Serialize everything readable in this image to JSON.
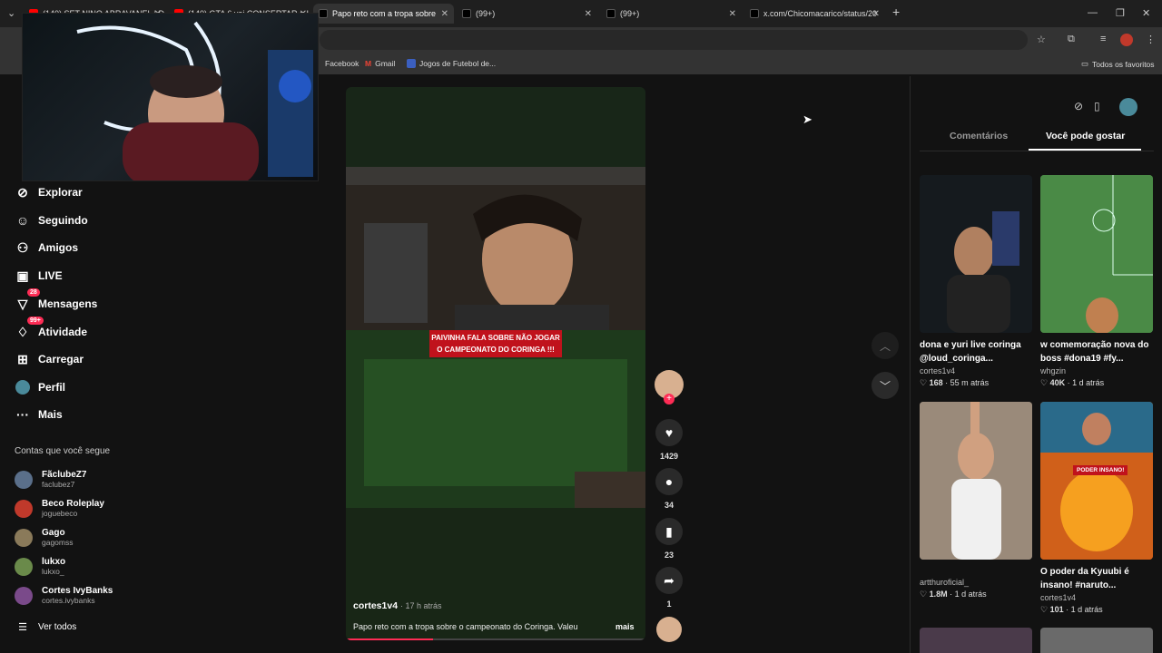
{
  "browser": {
    "tabs": [
      {
        "title": "(140) SET NINO ABRAVANEL | D",
        "color": "#ff0000"
      },
      {
        "title": "(140) GTA 6 vai CONSERTAR o I",
        "color": "#ff0000"
      },
      {
        "title": "Papo reto com a tropa sobre",
        "color": "#000000"
      },
      {
        "title": "(99+)",
        "color": "#000000"
      },
      {
        "title": "(99+)",
        "color": "#000000"
      },
      {
        "title": "x.com/Chicomacarico/status/20",
        "color": "#000000"
      }
    ],
    "bookmarks": [
      "Facebook",
      "Gmail",
      "Jogos de Futebol de...",
      "Todos os favoritos"
    ]
  },
  "sidebar": {
    "nav": [
      {
        "label": "Explorar",
        "icon": "compass-icon"
      },
      {
        "label": "Seguindo",
        "icon": "person-follow-icon"
      },
      {
        "label": "Amigos",
        "icon": "friends-icon"
      },
      {
        "label": "LIVE",
        "icon": "live-icon"
      },
      {
        "label": "Mensagens",
        "icon": "message-icon",
        "badge": "28"
      },
      {
        "label": "Atividade",
        "icon": "activity-icon",
        "badge": "99+"
      },
      {
        "label": "Carregar",
        "icon": "upload-icon"
      },
      {
        "label": "Perfil",
        "icon": "avatar-icon"
      },
      {
        "label": "Mais",
        "icon": "more-icon"
      }
    ],
    "following_title": "Contas que você segue",
    "following": [
      {
        "name": "FãclubeZ7",
        "handle": "faclubez7",
        "color": "#5a6f8a"
      },
      {
        "name": "Beco Roleplay",
        "handle": "joguebeco",
        "color": "#c0392b"
      },
      {
        "name": "Gago",
        "handle": "gagomss",
        "color": "#8a7a5a"
      },
      {
        "name": "lukxo",
        "handle": "lukxo_",
        "color": "#6a8a4a"
      },
      {
        "name": "Cortes IvyBanks",
        "handle": "cortes.ivybanks",
        "color": "#7a4a8a"
      }
    ],
    "see_all": "Ver todos"
  },
  "video": {
    "overlay_caption": "PAIVINHA FALA SOBRE NÃO JOGAR O CAMPEONATO DO CORINGA !!!",
    "author": "cortes1v4",
    "time": "17 h atrás",
    "description": "Papo reto com a tropa sobre o campeonato do Coringa. Valeu",
    "more": "mais",
    "progress": 0.29,
    "likes": "1429",
    "comments": "34",
    "saves": "23",
    "shares": "1"
  },
  "right_panel": {
    "tabs": [
      "Comentários",
      "Você pode gostar"
    ],
    "active_tab": "Você pode gostar",
    "cards": [
      {
        "title": "dona e yuri live coringa @loud_coringa...",
        "user": "cortes1v4",
        "likes": "168",
        "time": "55 m atrás"
      },
      {
        "title": "w comemoração nova do boss #dona19 #fy...",
        "user": "whgzin",
        "likes": "40K",
        "time": "1 d atrás"
      },
      {
        "title": "",
        "user": "artthuroficial_",
        "likes": "1.8M",
        "time": "1 d atrás"
      },
      {
        "title": "O poder da Kyuubi é insano! #naruto...",
        "user": "cortes1v4",
        "likes": "101",
        "time": "1 d atrás",
        "overlay": "PODER INSANO!"
      }
    ]
  },
  "colors": {
    "accent": "#fe2c55",
    "bg": "#121212"
  }
}
